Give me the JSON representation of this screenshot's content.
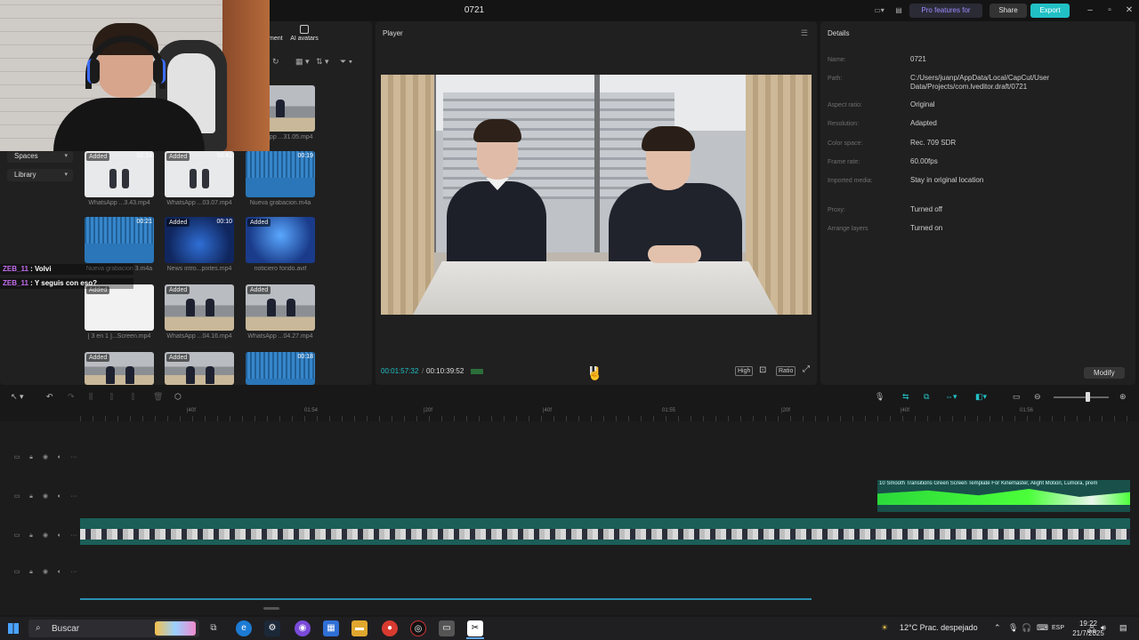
{
  "window": {
    "title": "0721"
  },
  "titlebar": {
    "pro_label": "Pro features for FREE",
    "share_label": "Share",
    "export_label": "Export"
  },
  "media": {
    "tab_ai_avatars": "AI avatars",
    "tab_partial": "ment",
    "sidebar": [
      {
        "label": "Spaces"
      },
      {
        "label": "Library"
      }
    ],
    "items": [
      {
        "badge": "",
        "duration": "",
        "name": "WhatsApp ...31.05.mp4"
      },
      {
        "badge": "Added",
        "duration": "00:24",
        "name": "WhatsApp ...3.43.mp4"
      },
      {
        "badge": "Added",
        "duration": "00:41",
        "name": "WhatsApp ...03.07.mp4"
      },
      {
        "badge": "",
        "duration": "00:19",
        "name": "Nueva grabacion.m4a"
      },
      {
        "badge": "",
        "duration": "00:21",
        "name": "Nueva grabacion 3.m4a"
      },
      {
        "badge": "Added",
        "duration": "00:10",
        "name": "News intro...pixtes.mp4"
      },
      {
        "badge": "Added",
        "duration": "",
        "name": "noticiero fondo.avif"
      },
      {
        "badge": "Added",
        "duration": "",
        "name": "[ 3 en 1 ]...Screen.mp4"
      },
      {
        "badge": "Added",
        "duration": "",
        "name": "WhatsApp ...04.16.mp4"
      },
      {
        "badge": "Added",
        "duration": "",
        "name": "WhatsApp ...04.27.mp4"
      },
      {
        "badge": "Added",
        "duration": "",
        "name": ""
      },
      {
        "badge": "Added",
        "duration": "",
        "name": ""
      },
      {
        "badge": "",
        "duration": "00:18",
        "name": ""
      }
    ]
  },
  "chat": [
    {
      "user": "ZEB_11",
      "message": " : Volvi"
    },
    {
      "user": "ZEB_11",
      "message": " : Y seguis con eso?"
    }
  ],
  "player": {
    "title": "Player",
    "current_time": "00:01:57:32",
    "total_time": "00:10:39:52",
    "quality_label": "High",
    "ratio_label": "Ratio"
  },
  "details": {
    "title": "Details",
    "rows": [
      {
        "label": "Name:",
        "value": "0721"
      },
      {
        "label": "Path:",
        "value": "C:/Users/juanp/AppData/Local/CapCut/User Data/Projects/com.lveditor.draft/0721"
      },
      {
        "label": "Aspect ratio:",
        "value": "Original"
      },
      {
        "label": "Resolution:",
        "value": "Adapted"
      },
      {
        "label": "Color space:",
        "value": "Rec. 709 SDR"
      },
      {
        "label": "Frame rate:",
        "value": "60.00fps"
      },
      {
        "label": "Imported media:",
        "value": "Stay in original location"
      },
      {
        "label": "Proxy:",
        "value": "Turned off"
      },
      {
        "label": "Arrange layers",
        "value": "Turned on"
      }
    ],
    "modify_label": "Modify"
  },
  "timeline": {
    "ruler": [
      "|40f",
      "01:54",
      "|20f",
      "|40f",
      "01:55",
      "|20f",
      "|40f",
      "01:56"
    ],
    "green_clip_title": "10 Smooth Transitions Green Screen Template For Kinemaster, Alight Motion, Lumora, prem"
  },
  "taskbar": {
    "search_placeholder": "Buscar",
    "weather": "12°C  Prac. despejado",
    "lang": "ESP",
    "time": "19:22",
    "date": "21/7/2025"
  },
  "colors": {
    "accent": "#21c0c5",
    "chat_user": "#c56cf0",
    "pro": "#9a8cff"
  }
}
